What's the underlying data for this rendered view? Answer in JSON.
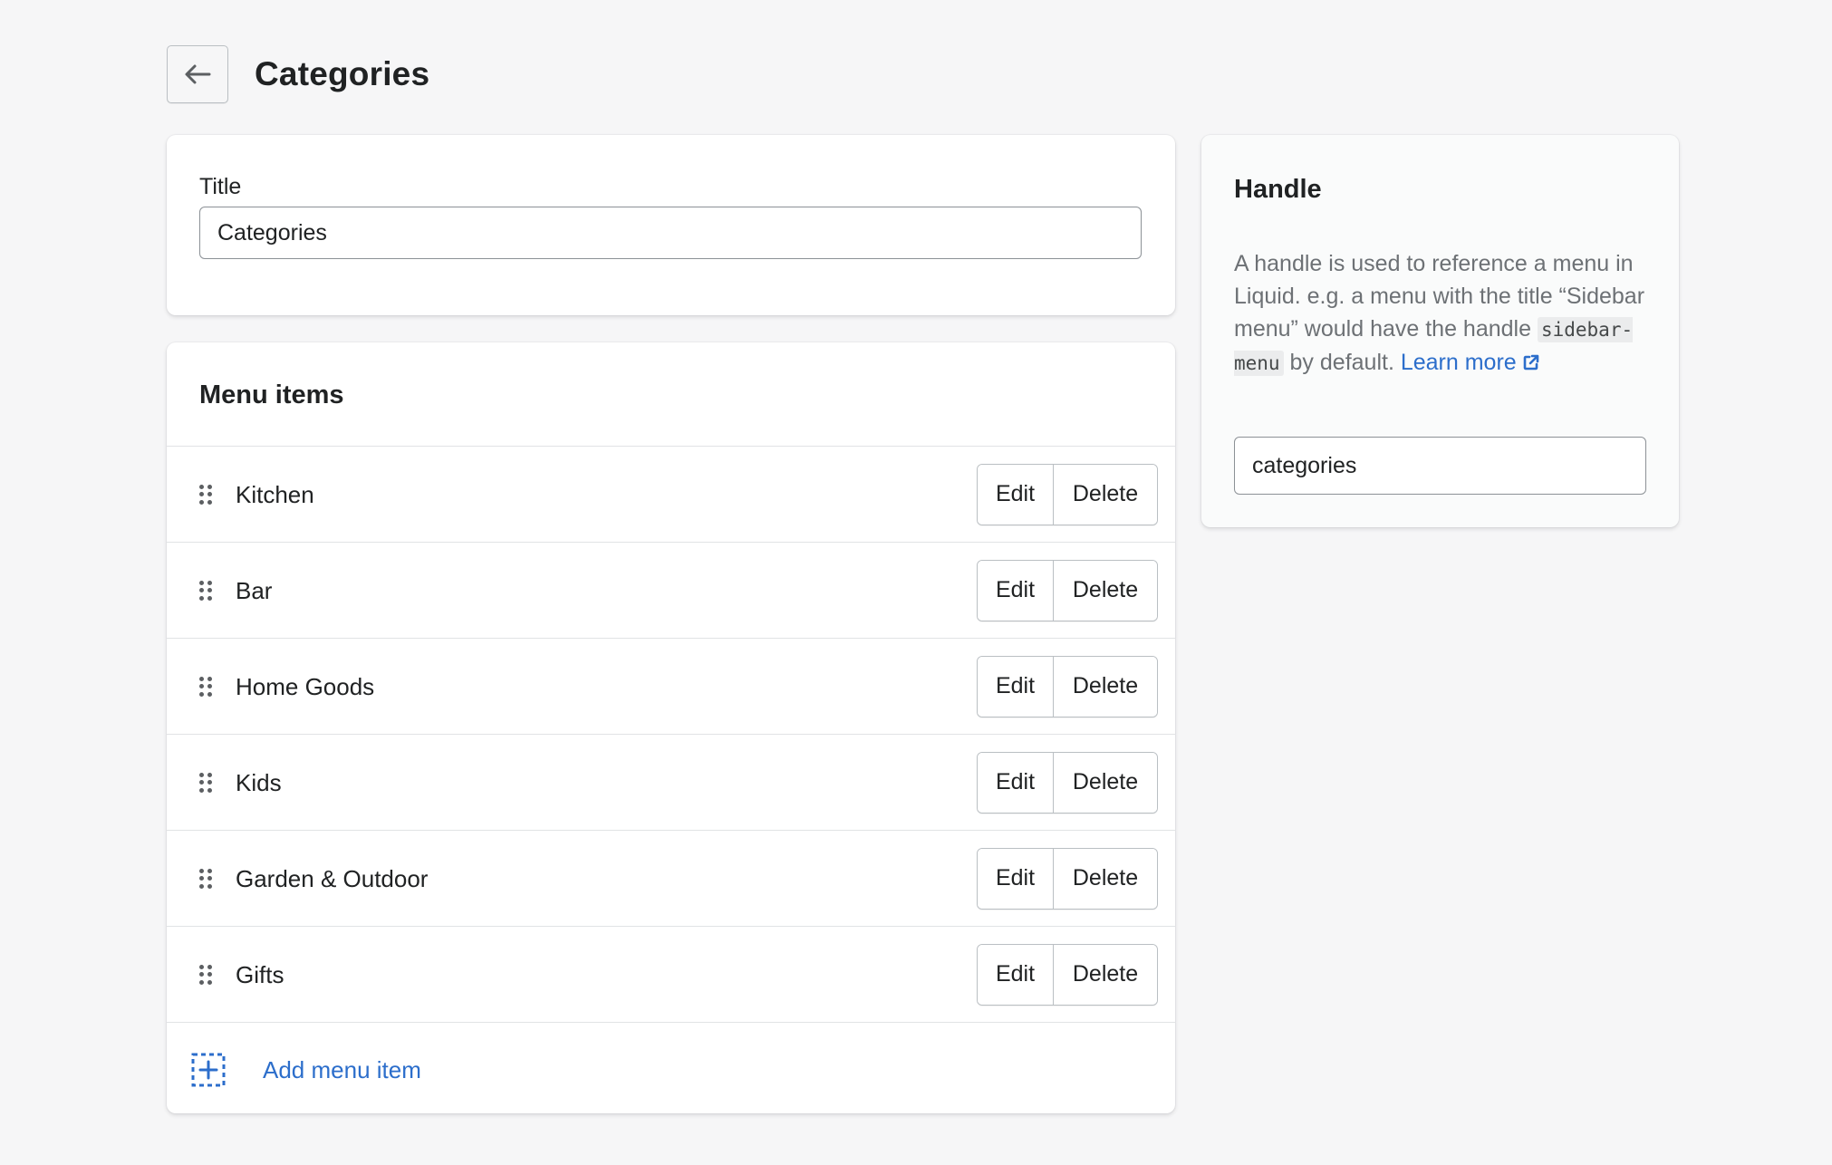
{
  "header": {
    "back_icon": "arrow-left-icon",
    "title": "Categories"
  },
  "title_card": {
    "label": "Title",
    "value": "Categories"
  },
  "menu": {
    "section_title": "Menu items",
    "drag_icon": "drag-handle-icon",
    "items": [
      {
        "label": "Kitchen",
        "edit": "Edit",
        "delete": "Delete"
      },
      {
        "label": "Bar",
        "edit": "Edit",
        "delete": "Delete"
      },
      {
        "label": "Home Goods",
        "edit": "Edit",
        "delete": "Delete"
      },
      {
        "label": "Kids",
        "edit": "Edit",
        "delete": "Delete"
      },
      {
        "label": "Garden & Outdoor",
        "edit": "Edit",
        "delete": "Delete"
      },
      {
        "label": "Gifts",
        "edit": "Edit",
        "delete": "Delete"
      }
    ],
    "add_icon": "add-dashed-square-icon",
    "add_label": "Add menu item"
  },
  "handle": {
    "title": "Handle",
    "description_before": "A handle is used to reference a menu in Liquid. e.g. a menu with the title “Sidebar menu” would have the handle",
    "code": "sidebar-menu",
    "description_after": "by default.",
    "link_text": "Learn more",
    "link_icon": "external-link-icon",
    "value": "categories"
  },
  "colors": {
    "background": "#f6f6f7",
    "card": "#ffffff",
    "link": "#2c6ecb",
    "text": "#202223",
    "subdued_text": "#6d7175",
    "border": "#babfc3"
  }
}
